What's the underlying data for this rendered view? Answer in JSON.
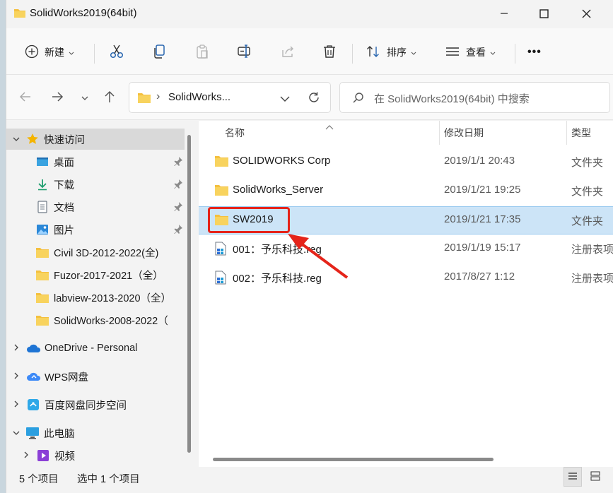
{
  "window": {
    "title": "SolidWorks2019(64bit)"
  },
  "toolbar": {
    "new_label": "新建",
    "sort_label": "排序",
    "view_label": "查看",
    "more_label": "•••"
  },
  "address": {
    "chevron": "›",
    "path": "SolidWorks..."
  },
  "search": {
    "placeholder": "在 SolidWorks2019(64bit) 中搜索"
  },
  "sidebar": {
    "items": [
      {
        "label": "快速访问",
        "icon": "star-icon"
      },
      {
        "label": "桌面",
        "icon": "desktop-icon"
      },
      {
        "label": "下载",
        "icon": "download-icon"
      },
      {
        "label": "文档",
        "icon": "document-icon"
      },
      {
        "label": "图片",
        "icon": "picture-icon"
      },
      {
        "label": "Civil 3D-2012-2022(全)",
        "icon": "folder-icon"
      },
      {
        "label": "Fuzor-2017-2021（全）",
        "icon": "folder-icon"
      },
      {
        "label": "labview-2013-2020（全）",
        "icon": "folder-icon"
      },
      {
        "label": "SolidWorks-2008-2022（",
        "icon": "folder-icon"
      },
      {
        "label": "OneDrive - Personal",
        "icon": "cloud-icon"
      },
      {
        "label": "WPS网盘",
        "icon": "cloud-icon"
      },
      {
        "label": "百度网盘同步空间",
        "icon": "baidu-sync-icon"
      },
      {
        "label": "此电脑",
        "icon": "computer-icon"
      },
      {
        "label": "视频",
        "icon": "video-icon"
      }
    ]
  },
  "list": {
    "columns": {
      "name": "名称",
      "date": "修改日期",
      "type": "类型"
    },
    "rows": [
      {
        "name": "SOLIDWORKS Corp",
        "date": "2019/1/1 20:43",
        "type": "文件夹",
        "icon": "folder-icon"
      },
      {
        "name": "SolidWorks_Server",
        "date": "2019/1/21 19:25",
        "type": "文件夹",
        "icon": "folder-icon"
      },
      {
        "name": "SW2019",
        "date": "2019/1/21 17:35",
        "type": "文件夹",
        "icon": "folder-icon"
      },
      {
        "name": "001：予乐科技.reg",
        "date": "2019/1/19 15:17",
        "type": "注册表项",
        "icon": "registry-file-icon"
      },
      {
        "name": "002：予乐科技.reg",
        "date": "2017/8/27 1:12",
        "type": "注册表项",
        "icon": "registry-file-icon"
      }
    ]
  },
  "status": {
    "count": "5 个项目",
    "selected": "选中 1 个项目"
  },
  "colors": {
    "selection": "#cce4f7",
    "highlight": "#e5241a",
    "folder": "#f4c03f"
  }
}
